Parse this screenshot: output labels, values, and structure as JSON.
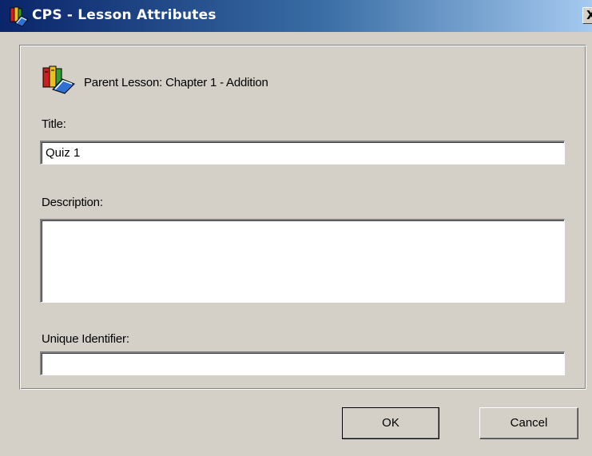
{
  "window": {
    "title": "CPS - Lesson Attributes",
    "close_symbol": "X",
    "titlebar_color_start": "#0a246a",
    "titlebar_color_end": "#a6caf0",
    "background_color": "#d4d0c8"
  },
  "header": {
    "parent_lesson": "Parent Lesson: Chapter 1 - Addition",
    "icon": "books-icon"
  },
  "form": {
    "title_label": "Title:",
    "title_value": "Quiz 1",
    "description_label": "Description:",
    "description_value": "",
    "identifier_label": "Unique Identifier:",
    "identifier_value": ""
  },
  "buttons": {
    "ok_label": "OK",
    "cancel_label": "Cancel"
  }
}
